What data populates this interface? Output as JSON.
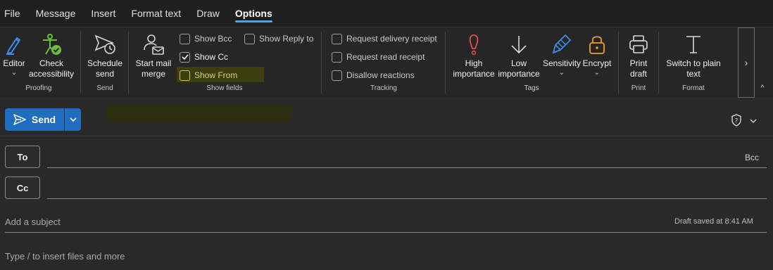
{
  "menu": {
    "tabs": [
      {
        "label": "File"
      },
      {
        "label": "Message"
      },
      {
        "label": "Insert"
      },
      {
        "label": "Format text"
      },
      {
        "label": "Draw"
      },
      {
        "label": "Options"
      }
    ],
    "active": "Options"
  },
  "ribbon": {
    "proofing": {
      "label": "Proofing",
      "editor": "Editor",
      "check": "Check accessibility"
    },
    "send": {
      "label": "Send",
      "schedule": "Schedule send"
    },
    "show_fields": {
      "label": "Show fields",
      "mail_merge": "Start mail merge",
      "show_bcc": "Show Bcc",
      "show_cc": "Show Cc",
      "show_from": "Show From",
      "show_reply_to": "Show Reply to",
      "show_cc_checked": true
    },
    "tracking": {
      "label": "Tracking",
      "delivery": "Request delivery receipt",
      "read": "Request read receipt",
      "disallow": "Disallow reactions"
    },
    "tags": {
      "label": "Tags",
      "high": "High importance",
      "low": "Low importance",
      "sensitivity": "Sensitivity",
      "encrypt": "Encrypt"
    },
    "print": {
      "label": "Print",
      "print_draft": "Print draft"
    },
    "format": {
      "label": "Format",
      "plain_text": "Switch to plain text"
    },
    "more": "›",
    "collapse": "^"
  },
  "compose": {
    "send_label": "Send",
    "to_label": "To",
    "cc_label": "Cc",
    "bcc_label": "Bcc",
    "subject_placeholder": "Add a subject",
    "draft_status": "Draft saved at 8:41 AM",
    "body_hint": "Type / to insert files and more"
  },
  "colors": {
    "accent": "#1f6dc1",
    "tab_underline": "#4ea3f1",
    "importance_high": "#e8495a",
    "accessibility_green": "#6bbf3a",
    "encrypt_orange": "#f0a020",
    "sensitivity_blue": "#3b8ee8"
  }
}
